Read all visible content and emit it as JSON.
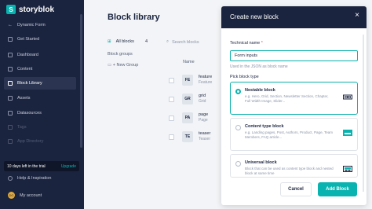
{
  "sidebar": {
    "logo": "storyblok",
    "logo_mark": "S",
    "space": "Dynamic Form",
    "items": [
      {
        "label": "Get Started",
        "icon": "rocket-icon"
      },
      {
        "label": "Dashboard",
        "icon": "dashboard-icon"
      },
      {
        "label": "Content",
        "icon": "content-icon"
      },
      {
        "label": "Block Library",
        "icon": "block-library-icon"
      },
      {
        "label": "Assets",
        "icon": "assets-icon"
      },
      {
        "label": "Datasources",
        "icon": "datasources-icon"
      },
      {
        "label": "Tags",
        "icon": "tags-icon"
      },
      {
        "label": "App Directory",
        "icon": "apps-icon"
      }
    ],
    "trial_text": "10 days left in the trial",
    "upgrade": "Upgrade",
    "help": "Help & Inspiration",
    "account": "My account",
    "avatar_initials": "DG"
  },
  "main": {
    "title": "Block library",
    "all_blocks": "All blocks",
    "all_count": "4",
    "groups_label": "Block groups",
    "new_group": "+ New Group",
    "search_placeholder": "Search blocks",
    "col_name": "Name",
    "rows": [
      {
        "badge": "FE",
        "name": "feature",
        "sub": "Feature"
      },
      {
        "badge": "GR",
        "name": "grid",
        "sub": "Grid"
      },
      {
        "badge": "PA",
        "name": "page",
        "sub": "Page"
      },
      {
        "badge": "TE",
        "name": "teaser",
        "sub": "Teaser"
      }
    ]
  },
  "modal": {
    "title": "Create new block",
    "close": "×",
    "tech_label": "Technical name",
    "required": "*",
    "tech_value": "Form inputs",
    "tech_hint": "Used in the JSON as block name",
    "type_label": "Pick block type",
    "types": [
      {
        "title": "Nestable block",
        "desc": "e.g. Hero, Grid, Section, Newsletter Section, Chapter, Full Width Image, Slider...",
        "selected": true
      },
      {
        "title": "Content type block",
        "desc": "e.g. Landing pages, Post, Authors, Product, Page, Team Members, FAQ article...",
        "selected": false
      },
      {
        "title": "Universal block",
        "desc": "Block that can be used as content type block and nested block at same time",
        "selected": false
      }
    ],
    "cancel": "Cancel",
    "add": "Add Block"
  },
  "colors": {
    "accent": "#09b3af",
    "sidebar_bg": "#1b243f"
  }
}
